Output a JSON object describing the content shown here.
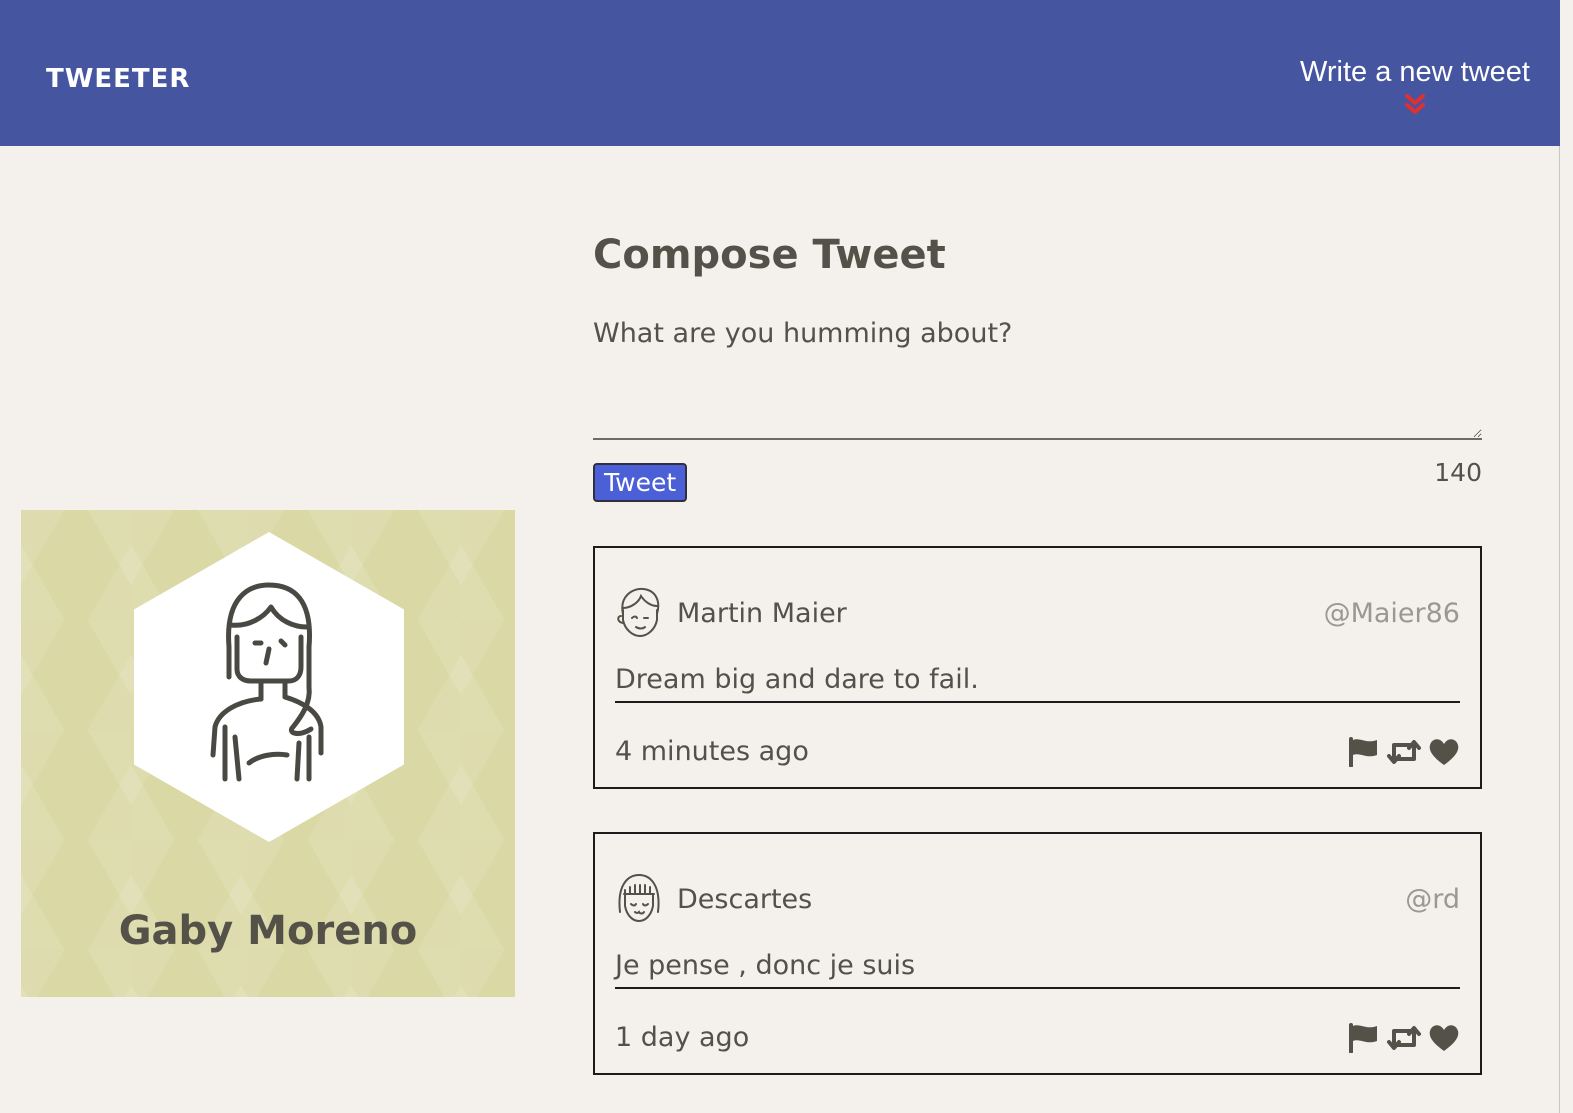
{
  "nav": {
    "logo": "TWEETER",
    "new_tweet_label": "Write a new tweet",
    "accent_color": "#e03030",
    "bg_color": "#4655a0"
  },
  "profile": {
    "name": "Gaby Moreno",
    "bg_color": "#dad8a5"
  },
  "compose": {
    "title": "Compose Tweet",
    "label": "What are you humming about?",
    "textarea_value": "",
    "button_label": "Tweet",
    "button_color": "#4b5fd6",
    "counter": "140"
  },
  "tweets": [
    {
      "name": "Martin Maier",
      "handle": "@Maier86",
      "text": "Dream big and dare to fail.",
      "time": "4 minutes ago",
      "avatar_icon": "male-avatar-icon"
    },
    {
      "name": "Descartes",
      "handle": "@rd",
      "text": "Je pense , donc je suis",
      "time": "1 day ago",
      "avatar_icon": "female-avatar-icon"
    }
  ],
  "tweet_actions": [
    "flag-icon",
    "retweet-icon",
    "heart-icon"
  ]
}
